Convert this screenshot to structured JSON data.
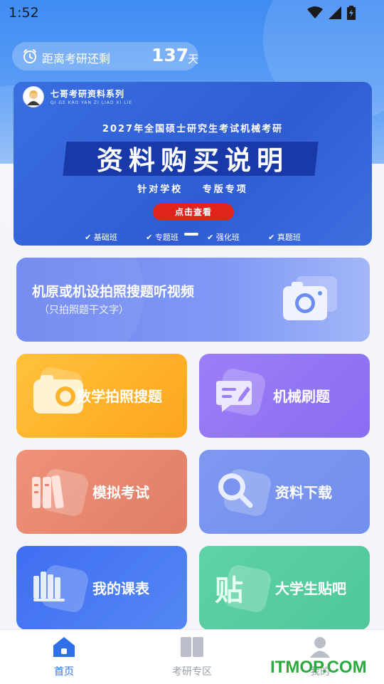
{
  "status_bar": {
    "time": "1:52"
  },
  "countdown": {
    "label": "距离考研还剩",
    "days": "137",
    "unit": "天"
  },
  "banner": {
    "brand": "七哥考研资料系列",
    "brand_sub": "QI GE KAO YAN ZI LIAO XI LIE",
    "subtitle": "2027年全国硕士研究生考试机械考研",
    "title": "资料购买说明",
    "tags": [
      "针对学校",
      "专版专项"
    ],
    "cta": "点击查看",
    "classes": [
      "基础班",
      "专题班",
      "强化班",
      "真题班"
    ]
  },
  "photo_search": {
    "title": "机原或机设拍照搜题听视频",
    "subtitle": "（只拍照题干文字）"
  },
  "tiles": [
    {
      "label": "数学拍照搜题",
      "icon": "camera-icon",
      "color": "#ffb02e"
    },
    {
      "label": "机械刷题",
      "icon": "message-edit-icon",
      "color": "#9a7bf6"
    },
    {
      "label": "模拟考试",
      "icon": "books-icon",
      "color": "#ec8a6e"
    },
    {
      "label": "资料下载",
      "icon": "search-icon",
      "color": "#7a95ef"
    },
    {
      "label": "我的课表",
      "icon": "bookshelf-icon",
      "color": "#3e73f2"
    },
    {
      "label": "大学生贴吧",
      "icon": "sticker-icon",
      "color": "#5ccda3"
    }
  ],
  "bottom_nav": [
    {
      "label": "首页",
      "icon": "home-icon",
      "active": true
    },
    {
      "label": "考研专区",
      "icon": "book-icon",
      "active": false
    },
    {
      "label": "我的",
      "icon": "user-icon",
      "active": false
    }
  ],
  "watermark": "ITMOP.COM",
  "colors": {
    "accent": "#3f8cf3",
    "nav_active": "#2f6fe8",
    "nav_inactive": "#9aa0aa",
    "cta_red": "#e0231d"
  }
}
